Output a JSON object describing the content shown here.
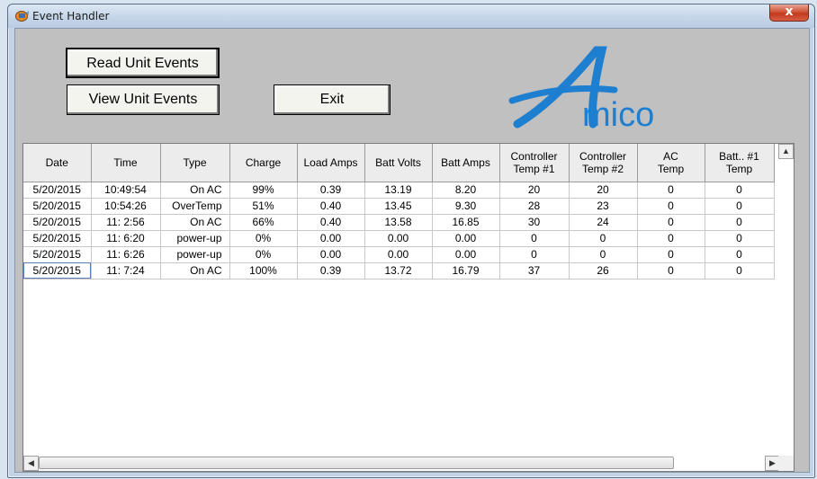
{
  "window": {
    "title": "Event Handler",
    "close_label": "x"
  },
  "buttons": {
    "read_events": "Read Unit Events",
    "view_events": "View Unit Events",
    "exit": "Exit"
  },
  "logo": {
    "text": "mico",
    "letter": "A",
    "color": "#1e7fd0"
  },
  "table": {
    "headers": [
      "Date",
      "Time",
      "Type",
      "Charge",
      "Load  Amps",
      "Batt Volts",
      "Batt Amps",
      "Controller\nTemp #1",
      "Controller\nTemp #2",
      "AC\nTemp",
      "Batt.. #1\nTemp"
    ],
    "rows": [
      [
        "5/20/2015",
        "10:49:54",
        "On AC",
        "99%",
        "0.39",
        "13.19",
        "8.20",
        "20",
        "20",
        "0",
        "0"
      ],
      [
        "5/20/2015",
        "10:54:26",
        "OverTemp",
        "51%",
        "0.40",
        "13.45",
        "9.30",
        "28",
        "23",
        "0",
        "0"
      ],
      [
        "5/20/2015",
        "11: 2:56",
        "On AC",
        "66%",
        "0.40",
        "13.58",
        "16.85",
        "30",
        "24",
        "0",
        "0"
      ],
      [
        "5/20/2015",
        "11: 6:20",
        "power-up",
        "0%",
        "0.00",
        "0.00",
        "0.00",
        "0",
        "0",
        "0",
        "0"
      ],
      [
        "5/20/2015",
        "11: 6:26",
        "power-up",
        "0%",
        "0.00",
        "0.00",
        "0.00",
        "0",
        "0",
        "0",
        "0"
      ],
      [
        "5/20/2015",
        "11: 7:24",
        "On AC",
        "100%",
        "0.39",
        "13.72",
        "16.79",
        "37",
        "26",
        "0",
        "0"
      ]
    ]
  }
}
